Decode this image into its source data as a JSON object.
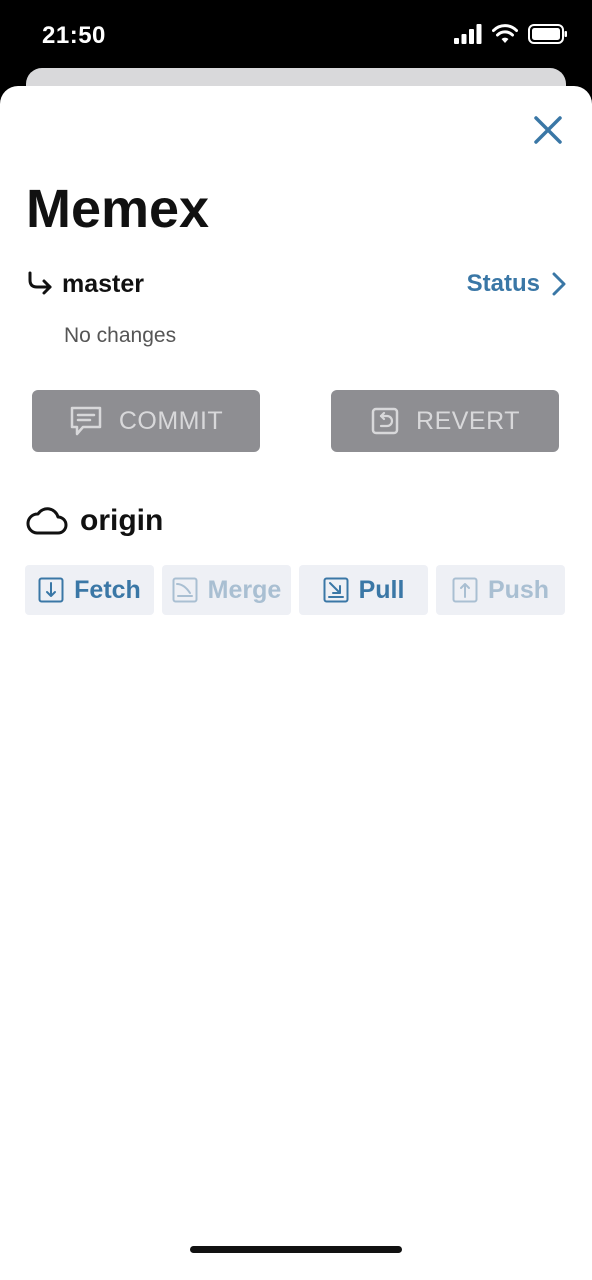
{
  "status_bar": {
    "time": "21:50",
    "icons": [
      "signal-icon",
      "wifi-icon",
      "battery-icon"
    ]
  },
  "sheet": {
    "close_icon": "close-icon",
    "title": "Memex",
    "branch": {
      "icon": "branch-arrow-icon",
      "name": "master",
      "status_label": "Status",
      "status_icon": "chevron-right-icon",
      "changes_text": "No changes"
    },
    "buttons": {
      "commit_label": "COMMIT",
      "commit_icon": "comment-icon",
      "revert_label": "REVERT",
      "revert_icon": "revert-icon"
    },
    "remote": {
      "icon": "cloud-icon",
      "name": "origin",
      "actions": [
        {
          "label": "Fetch",
          "icon": "fetch-icon",
          "enabled": "true"
        },
        {
          "label": "Merge",
          "icon": "merge-icon",
          "enabled": "false"
        },
        {
          "label": "Pull",
          "icon": "pull-icon",
          "enabled": "true"
        },
        {
          "label": "Push",
          "icon": "push-icon",
          "enabled": "false"
        }
      ]
    }
  },
  "colors": {
    "accent": "#3a77a6",
    "accent_disabled": "#a9bfd2",
    "button_gray": "#8e8e92",
    "action_bg": "#eef0f5"
  }
}
